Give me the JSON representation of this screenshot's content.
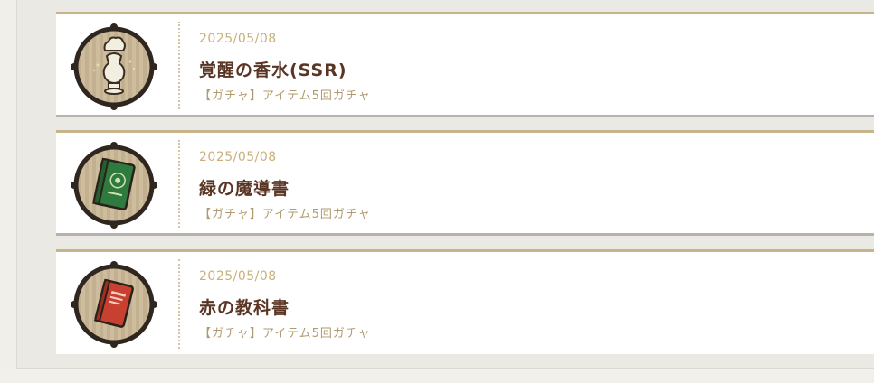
{
  "items": [
    {
      "date": "2025/05/08",
      "name": "覚醒の香水(SSR)",
      "source": "【ガチャ】アイテム5回ガチャ",
      "icon": "perfume-vase-icon"
    },
    {
      "date": "2025/05/08",
      "name": "緑の魔導書",
      "source": "【ガチャ】アイテム5回ガチャ",
      "icon": "green-grimoire-icon"
    },
    {
      "date": "2025/05/08",
      "name": "赤の教科書",
      "source": "【ガチャ】アイテム5回ガチャ",
      "icon": "red-textbook-icon"
    }
  ],
  "colors": {
    "date": "#c9b07a",
    "title": "#5a3524",
    "source": "#b09a6f",
    "card_top_border": "#c7b48a",
    "icon_ring": "#2f2620",
    "icon_fill": "#c9b99a"
  }
}
